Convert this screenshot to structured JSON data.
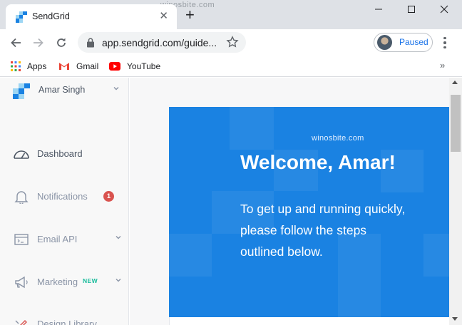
{
  "browser": {
    "tab_title": "SendGrid",
    "tab_favicon": "sendgrid-logo-icon",
    "top_watermark": "winosbite.com",
    "new_tab_symbol": "+",
    "close_tab_symbol": "✕",
    "url": "app.sendgrid.com/guide...",
    "profile_label": "Paused",
    "overflow_symbol": "»",
    "bookmarks": [
      {
        "label": "Apps",
        "icon": "apps-grid-icon"
      },
      {
        "label": "Gmail",
        "icon": "gmail-icon"
      },
      {
        "label": "YouTube",
        "icon": "youtube-icon"
      }
    ]
  },
  "sidebar": {
    "account_name": "Amar Singh",
    "items": [
      {
        "label": "Dashboard",
        "icon": "gauge-icon",
        "active": true
      },
      {
        "label": "Notifications",
        "icon": "bell-icon",
        "badge": "1"
      },
      {
        "label": "Email API",
        "icon": "code-window-icon",
        "expandable": true
      },
      {
        "label": "Marketing",
        "icon": "megaphone-icon",
        "tag": "NEW",
        "expandable": true
      },
      {
        "label": "Design Library",
        "icon": "design-tools-icon"
      }
    ]
  },
  "main": {
    "watermark": "winosbite.com",
    "title": "Welcome, Amar!",
    "body_lines": [
      "To get up and running quickly,",
      "please follow the steps",
      "outlined below."
    ]
  },
  "colors": {
    "banner": "#1a82e2",
    "tab_strip": "#dee1e6",
    "badge": "#d9534f",
    "new_tag": "#1abc9c",
    "profile_text": "#1a73e8"
  }
}
